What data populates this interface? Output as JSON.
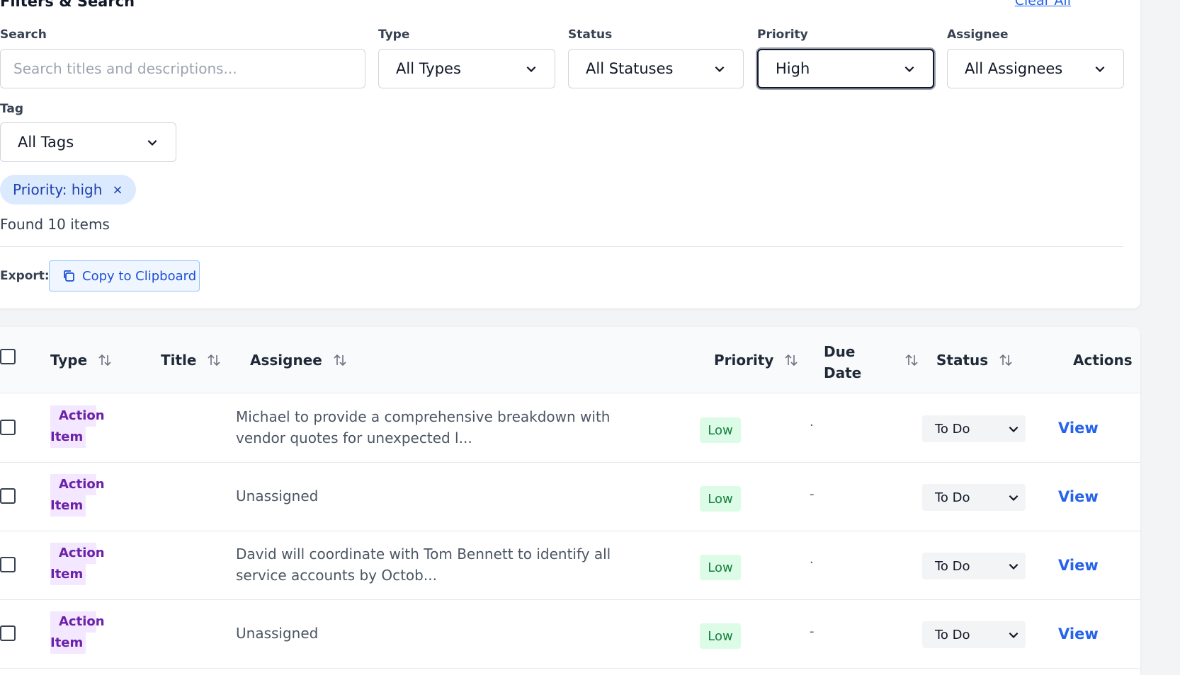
{
  "filters": {
    "title": "Filters & Search",
    "clear_all": "Clear All",
    "search": {
      "label": "Search",
      "placeholder": "Search titles and descriptions..."
    },
    "type": {
      "label": "Type",
      "value": "All Types"
    },
    "status": {
      "label": "Status",
      "value": "All Statuses"
    },
    "priority": {
      "label": "Priority",
      "value": "High"
    },
    "assignee": {
      "label": "Assignee",
      "value": "All Assignees"
    },
    "tag": {
      "label": "Tag",
      "value": "All Tags"
    },
    "active_chip": "Priority: high",
    "chip_remove": "×",
    "found": "Found 10 items",
    "export_label": "Export:",
    "copy_button": "Copy to Clipboard"
  },
  "table": {
    "headers": {
      "type": "Type",
      "title": "Title",
      "assignee": "Assignee",
      "priority": "Priority",
      "due_date_line1": "Due",
      "due_date_line2": "Date",
      "status": "Status",
      "actions": "Actions"
    },
    "rows": [
      {
        "type_l1": "Action",
        "type_l2": "Item",
        "assignee": "Michael to provide a comprehensive breakdown with vendor quotes for unexpected l...",
        "priority": "Low",
        "due": "·",
        "status": "To Do",
        "action": "View"
      },
      {
        "type_l1": "Action",
        "type_l2": "Item",
        "assignee": "Unassigned",
        "priority": "Low",
        "due": "-",
        "status": "To Do",
        "action": "View"
      },
      {
        "type_l1": "Action",
        "type_l2": "Item",
        "assignee": "David will coordinate with Tom Bennett to identify all service accounts by Octob...",
        "priority": "Low",
        "due": "·",
        "status": "To Do",
        "action": "View"
      },
      {
        "type_l1": "Action",
        "type_l2": "Item",
        "assignee": "Unassigned",
        "priority": "Low",
        "due": "-",
        "status": "To Do",
        "action": "View"
      }
    ]
  },
  "colors": {
    "accent": "#2563eb",
    "chip_bg": "#dbeafe",
    "type_badge_bg": "#f3e8ff",
    "priority_low_bg": "#dcfce7"
  }
}
